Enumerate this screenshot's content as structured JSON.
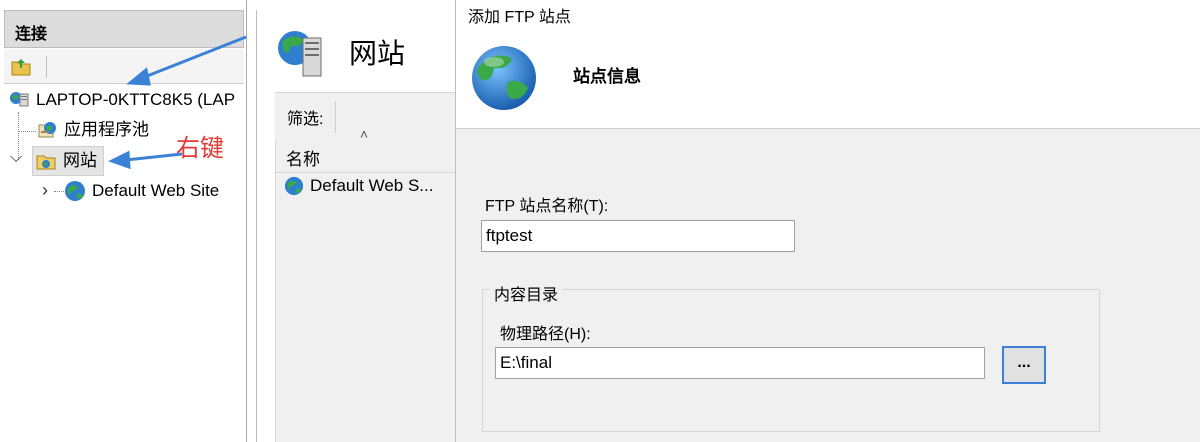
{
  "connections": {
    "header": "连接",
    "tree": {
      "computer": "LAPTOP-0KTTC8K5 (LAP",
      "app_pools": "应用程序池",
      "sites": "网站",
      "default_site": "Default Web Site"
    }
  },
  "sites_panel": {
    "title": "网站",
    "filter_label": "筛选:",
    "column_name": "名称",
    "items": [
      "Default Web S..."
    ]
  },
  "dialog": {
    "title": "添加 FTP 站点",
    "banner_title": "站点信息",
    "site_name_label": "FTP 站点名称(T):",
    "site_name_value": "ftptest",
    "content_dir_group": "内容目录",
    "physical_path_label": "物理路径(H):",
    "physical_path_value": "E:\\final",
    "browse_label": "..."
  },
  "annotation": {
    "label": "右键",
    "color": "#e53935",
    "arrow_color": "#3b82d6"
  },
  "icons": [
    "folder-up-icon",
    "computer-icon",
    "app-pool-icon",
    "sites-folder-icon",
    "globe-icon",
    "server-icon"
  ]
}
